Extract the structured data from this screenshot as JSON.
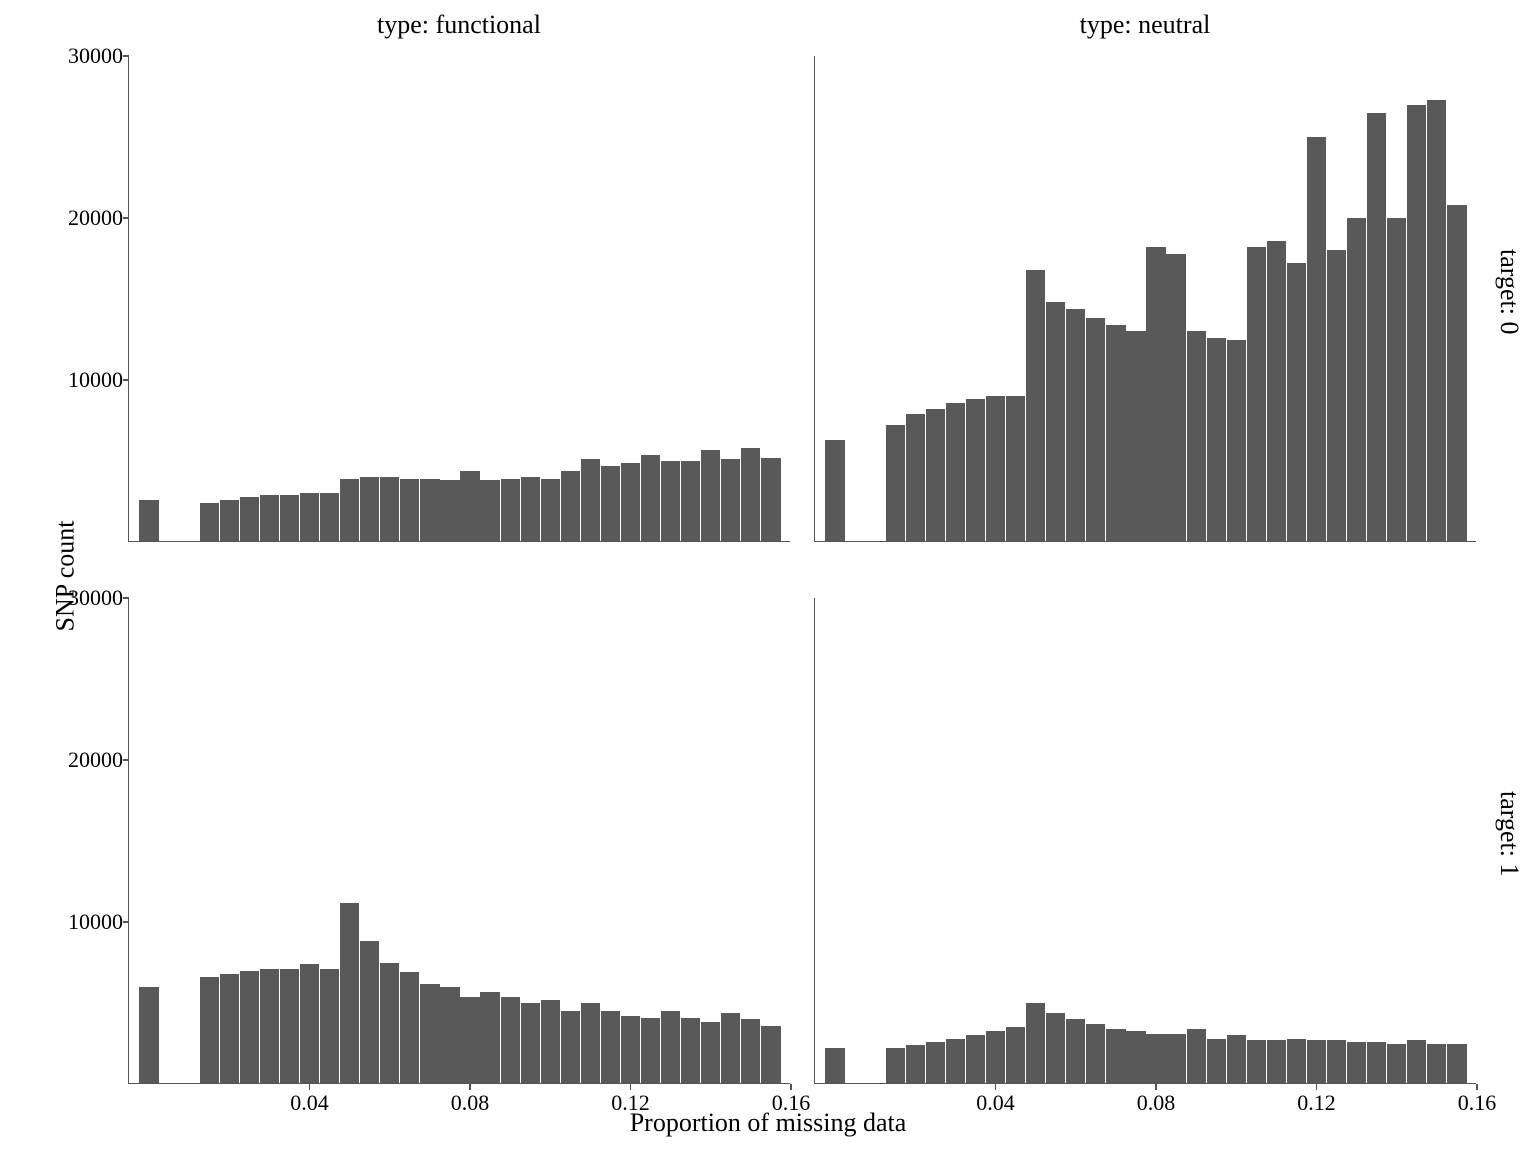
{
  "chart_data": {
    "type": "bar",
    "xlabel": "Proportion of missing data",
    "ylabel": "SNP count",
    "col_facet_labels": [
      "type: functional",
      "type: neutral"
    ],
    "row_facet_labels": [
      "target: 0",
      "target: 1"
    ],
    "x_ticks": [
      0.04,
      0.08,
      0.12,
      0.16
    ],
    "y_ticks": [
      10000,
      20000,
      30000
    ],
    "xlim": [
      -0.005,
      0.16
    ],
    "ylim": [
      0,
      30000
    ],
    "bin_centers": [
      0,
      0.01,
      0.015,
      0.02,
      0.025,
      0.03,
      0.035,
      0.04,
      0.045,
      0.05,
      0.055,
      0.06,
      0.065,
      0.07,
      0.075,
      0.08,
      0.085,
      0.09,
      0.095,
      0.1,
      0.105,
      0.11,
      0.115,
      0.12,
      0.125,
      0.13,
      0.135,
      0.14,
      0.145,
      0.15,
      0.155
    ],
    "panels": [
      {
        "col": "functional",
        "row": 0,
        "values": [
          2600,
          0,
          2400,
          2600,
          2800,
          2900,
          2900,
          3000,
          3000,
          3900,
          4000,
          4000,
          3900,
          3900,
          3800,
          4400,
          3800,
          3900,
          4000,
          3900,
          4400,
          5100,
          4700,
          4900,
          5400,
          5000,
          5000,
          5700,
          5100,
          5800,
          5200
        ]
      },
      {
        "col": "neutral",
        "row": 0,
        "values": [
          6300,
          0,
          7200,
          7900,
          8200,
          8600,
          8800,
          9000,
          9000,
          16800,
          14800,
          14400,
          13800,
          13400,
          13000,
          18200,
          17800,
          13000,
          12600,
          12500,
          18200,
          18600,
          17200,
          25000,
          18000,
          20000,
          26500,
          20000,
          27000,
          27300,
          20800
        ]
      },
      {
        "col": "functional",
        "row": 1,
        "values": [
          6000,
          0,
          6600,
          6800,
          7000,
          7100,
          7100,
          7400,
          7100,
          11200,
          8800,
          7500,
          6900,
          6200,
          6000,
          5400,
          5700,
          5400,
          5000,
          5200,
          4500,
          5000,
          4500,
          4200,
          4100,
          4500,
          4100,
          3800,
          4400,
          4000,
          3600
        ]
      },
      {
        "col": "neutral",
        "row": 1,
        "values": [
          2200,
          0,
          2200,
          2400,
          2600,
          2800,
          3000,
          3300,
          3500,
          5000,
          4400,
          4000,
          3700,
          3400,
          3300,
          3100,
          3100,
          3400,
          2800,
          3000,
          2700,
          2700,
          2800,
          2700,
          2700,
          2600,
          2600,
          2500,
          2700,
          2500,
          2500
        ]
      }
    ]
  }
}
